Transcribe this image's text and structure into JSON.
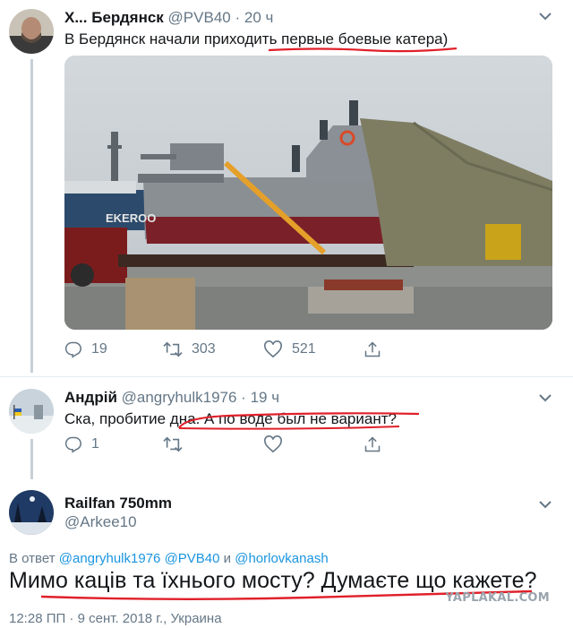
{
  "tweet1": {
    "name": "Х... Бердянск",
    "handle": "@PVB40",
    "dot": "·",
    "time": "20 ч",
    "text_before": "В Бердянск начали приходить ",
    "text_highlight": "первые боевые катера",
    "text_after": ")",
    "image_text": "EKEROO",
    "replies": "19",
    "retweets": "303",
    "likes": "521"
  },
  "tweet2": {
    "name": "Андрій",
    "handle": "@angryhulk1976",
    "dot": "·",
    "time": "19 ч",
    "text_before": "Ска, пробитие дна",
    "text_highlight": ". А по воде  был не вариант?",
    "replies": "1"
  },
  "tweet3": {
    "name": "Railfan 750mm",
    "handle": "@Arkee10",
    "reply_prefix": "В ответ ",
    "reply_mention_1": "@angryhulk1976",
    "reply_mention_2": "@PVB40",
    "reply_and": " и ",
    "reply_mention_3": "@horlovkanash",
    "text": "Мимо каців та їхнього мосту? Думаєте що кажете?",
    "meta": "12:28 ПП · 9 сент. 2018 г., Украина"
  },
  "watermark": "YAPLAKAL.COM",
  "colors": {
    "accent": "#1b95e0",
    "underline": "#e0202a",
    "secondary_text": "#657786"
  }
}
